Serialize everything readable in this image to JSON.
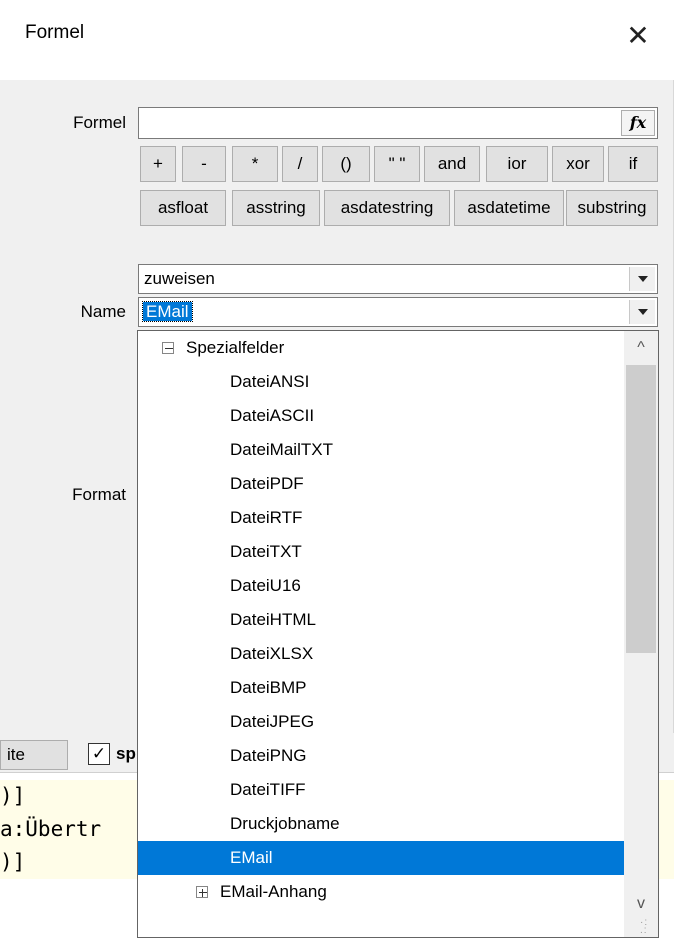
{
  "dialog": {
    "title": "Formel",
    "close_glyph": "✕"
  },
  "formula": {
    "label": "Formel",
    "value": "",
    "fx_label": "fx",
    "operators": [
      "+",
      "-",
      "*",
      "/",
      "()",
      "\" \"",
      "and",
      "ior",
      "xor",
      "if"
    ],
    "functions": [
      "asfloat",
      "asstring",
      "asdatestring",
      "asdatetime",
      "substring"
    ]
  },
  "assign": {
    "value": "zuweisen"
  },
  "name": {
    "label": "Name",
    "value": "EMail"
  },
  "format": {
    "label": "Format"
  },
  "dropdown": {
    "items": [
      {
        "label": "Spezialfelder",
        "level": 0,
        "expander": "minus"
      },
      {
        "label": "DateiANSI",
        "level": 1
      },
      {
        "label": "DateiASCII",
        "level": 1
      },
      {
        "label": "DateiMailTXT",
        "level": 1
      },
      {
        "label": "DateiPDF",
        "level": 1
      },
      {
        "label": "DateiRTF",
        "level": 1
      },
      {
        "label": "DateiTXT",
        "level": 1
      },
      {
        "label": "DateiU16",
        "level": 1
      },
      {
        "label": "DateiHTML",
        "level": 1
      },
      {
        "label": "DateiXLSX",
        "level": 1
      },
      {
        "label": "DateiBMP",
        "level": 1
      },
      {
        "label": "DateiJPEG",
        "level": 1
      },
      {
        "label": "DateiPNG",
        "level": 1
      },
      {
        "label": "DateiTIFF",
        "level": 1
      },
      {
        "label": "Druckjobname",
        "level": 1
      },
      {
        "label": "EMail",
        "level": 1,
        "selected": true
      },
      {
        "label": "EMail-Anhang",
        "level": 0,
        "expander": "plus"
      }
    ],
    "scroll_up": "^",
    "scroll_down": "v"
  },
  "background": {
    "tab_label": "ite",
    "checkbox_label": "sp",
    "checkbox_checked": "✓",
    "code_lines": [
      ")]",
      "a:Übertr",
      ")]"
    ]
  },
  "colors": {
    "selection": "#0078d7",
    "dialog_bg": "#f0f0f0"
  }
}
